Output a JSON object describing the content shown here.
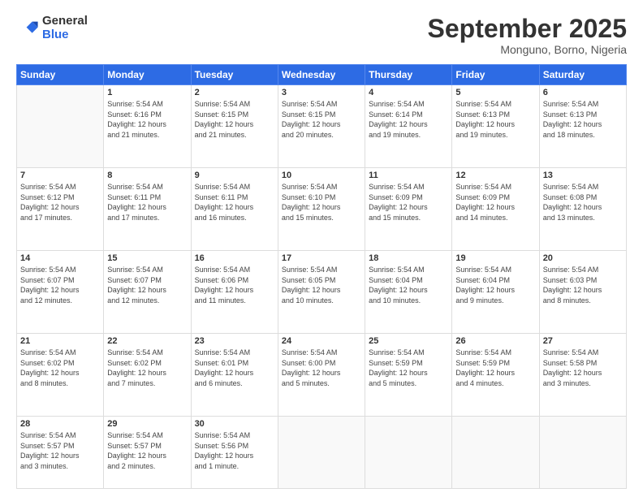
{
  "logo": {
    "general": "General",
    "blue": "Blue"
  },
  "header": {
    "month": "September 2025",
    "location": "Monguno, Borno, Nigeria"
  },
  "weekdays": [
    "Sunday",
    "Monday",
    "Tuesday",
    "Wednesday",
    "Thursday",
    "Friday",
    "Saturday"
  ],
  "weeks": [
    [
      {
        "day": "",
        "info": ""
      },
      {
        "day": "1",
        "info": "Sunrise: 5:54 AM\nSunset: 6:16 PM\nDaylight: 12 hours\nand 21 minutes."
      },
      {
        "day": "2",
        "info": "Sunrise: 5:54 AM\nSunset: 6:15 PM\nDaylight: 12 hours\nand 21 minutes."
      },
      {
        "day": "3",
        "info": "Sunrise: 5:54 AM\nSunset: 6:15 PM\nDaylight: 12 hours\nand 20 minutes."
      },
      {
        "day": "4",
        "info": "Sunrise: 5:54 AM\nSunset: 6:14 PM\nDaylight: 12 hours\nand 19 minutes."
      },
      {
        "day": "5",
        "info": "Sunrise: 5:54 AM\nSunset: 6:13 PM\nDaylight: 12 hours\nand 19 minutes."
      },
      {
        "day": "6",
        "info": "Sunrise: 5:54 AM\nSunset: 6:13 PM\nDaylight: 12 hours\nand 18 minutes."
      }
    ],
    [
      {
        "day": "7",
        "info": "Sunrise: 5:54 AM\nSunset: 6:12 PM\nDaylight: 12 hours\nand 17 minutes."
      },
      {
        "day": "8",
        "info": "Sunrise: 5:54 AM\nSunset: 6:11 PM\nDaylight: 12 hours\nand 17 minutes."
      },
      {
        "day": "9",
        "info": "Sunrise: 5:54 AM\nSunset: 6:11 PM\nDaylight: 12 hours\nand 16 minutes."
      },
      {
        "day": "10",
        "info": "Sunrise: 5:54 AM\nSunset: 6:10 PM\nDaylight: 12 hours\nand 15 minutes."
      },
      {
        "day": "11",
        "info": "Sunrise: 5:54 AM\nSunset: 6:09 PM\nDaylight: 12 hours\nand 15 minutes."
      },
      {
        "day": "12",
        "info": "Sunrise: 5:54 AM\nSunset: 6:09 PM\nDaylight: 12 hours\nand 14 minutes."
      },
      {
        "day": "13",
        "info": "Sunrise: 5:54 AM\nSunset: 6:08 PM\nDaylight: 12 hours\nand 13 minutes."
      }
    ],
    [
      {
        "day": "14",
        "info": "Sunrise: 5:54 AM\nSunset: 6:07 PM\nDaylight: 12 hours\nand 12 minutes."
      },
      {
        "day": "15",
        "info": "Sunrise: 5:54 AM\nSunset: 6:07 PM\nDaylight: 12 hours\nand 12 minutes."
      },
      {
        "day": "16",
        "info": "Sunrise: 5:54 AM\nSunset: 6:06 PM\nDaylight: 12 hours\nand 11 minutes."
      },
      {
        "day": "17",
        "info": "Sunrise: 5:54 AM\nSunset: 6:05 PM\nDaylight: 12 hours\nand 10 minutes."
      },
      {
        "day": "18",
        "info": "Sunrise: 5:54 AM\nSunset: 6:04 PM\nDaylight: 12 hours\nand 10 minutes."
      },
      {
        "day": "19",
        "info": "Sunrise: 5:54 AM\nSunset: 6:04 PM\nDaylight: 12 hours\nand 9 minutes."
      },
      {
        "day": "20",
        "info": "Sunrise: 5:54 AM\nSunset: 6:03 PM\nDaylight: 12 hours\nand 8 minutes."
      }
    ],
    [
      {
        "day": "21",
        "info": "Sunrise: 5:54 AM\nSunset: 6:02 PM\nDaylight: 12 hours\nand 8 minutes."
      },
      {
        "day": "22",
        "info": "Sunrise: 5:54 AM\nSunset: 6:02 PM\nDaylight: 12 hours\nand 7 minutes."
      },
      {
        "day": "23",
        "info": "Sunrise: 5:54 AM\nSunset: 6:01 PM\nDaylight: 12 hours\nand 6 minutes."
      },
      {
        "day": "24",
        "info": "Sunrise: 5:54 AM\nSunset: 6:00 PM\nDaylight: 12 hours\nand 5 minutes."
      },
      {
        "day": "25",
        "info": "Sunrise: 5:54 AM\nSunset: 5:59 PM\nDaylight: 12 hours\nand 5 minutes."
      },
      {
        "day": "26",
        "info": "Sunrise: 5:54 AM\nSunset: 5:59 PM\nDaylight: 12 hours\nand 4 minutes."
      },
      {
        "day": "27",
        "info": "Sunrise: 5:54 AM\nSunset: 5:58 PM\nDaylight: 12 hours\nand 3 minutes."
      }
    ],
    [
      {
        "day": "28",
        "info": "Sunrise: 5:54 AM\nSunset: 5:57 PM\nDaylight: 12 hours\nand 3 minutes."
      },
      {
        "day": "29",
        "info": "Sunrise: 5:54 AM\nSunset: 5:57 PM\nDaylight: 12 hours\nand 2 minutes."
      },
      {
        "day": "30",
        "info": "Sunrise: 5:54 AM\nSunset: 5:56 PM\nDaylight: 12 hours\nand 1 minute."
      },
      {
        "day": "",
        "info": ""
      },
      {
        "day": "",
        "info": ""
      },
      {
        "day": "",
        "info": ""
      },
      {
        "day": "",
        "info": ""
      }
    ]
  ]
}
